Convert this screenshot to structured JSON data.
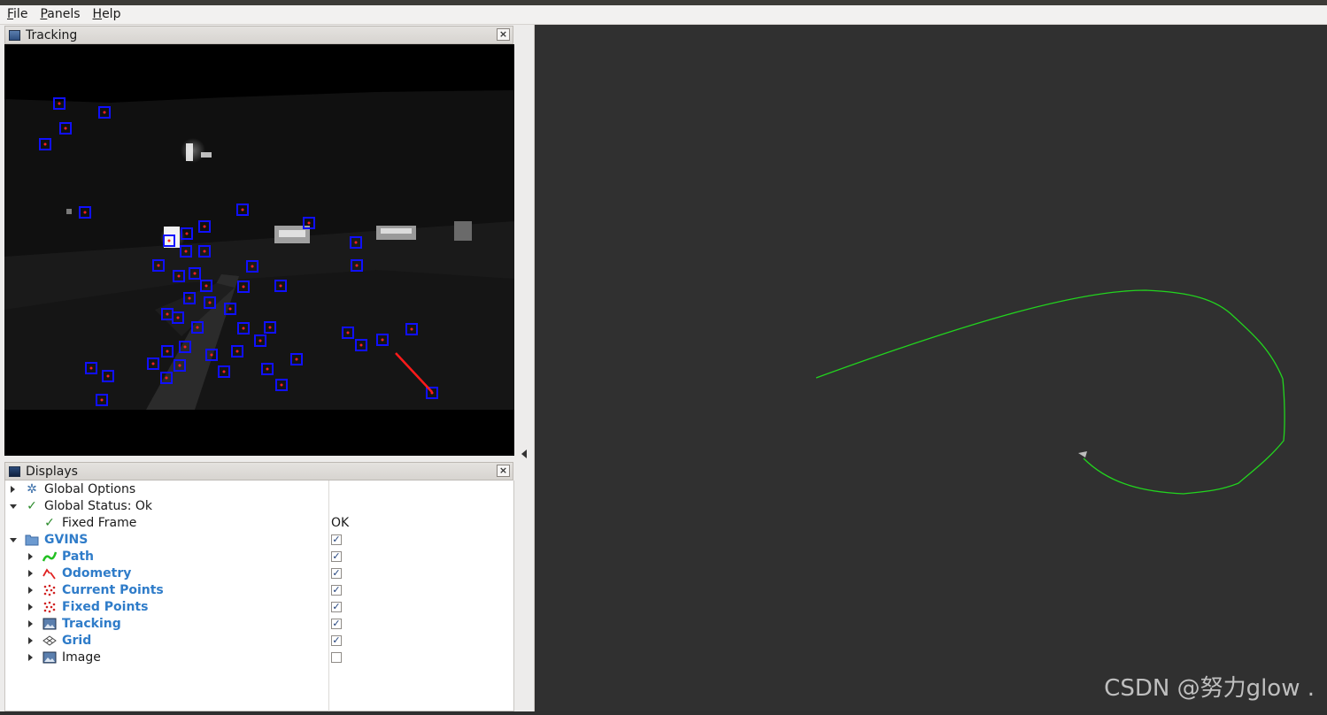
{
  "menu": {
    "file": {
      "acc": "F",
      "rest": "ile"
    },
    "panels": {
      "acc": "P",
      "rest": "anels"
    },
    "help": {
      "acc": "H",
      "rest": "elp"
    }
  },
  "tracking_panel": {
    "title": "Tracking",
    "close": "×"
  },
  "displays_panel": {
    "title": "Displays",
    "close": "×",
    "rows": [
      {
        "label": "Global Options",
        "icon": "gear-icon"
      },
      {
        "label": "Global Status: Ok",
        "icon": "check-icon"
      },
      {
        "label": "Fixed Frame",
        "icon": "check-icon",
        "value": "OK"
      },
      {
        "label": "GVINS",
        "icon": "folder-icon",
        "checked": true
      },
      {
        "label": "Path",
        "icon": "path-icon",
        "checked": true
      },
      {
        "label": "Odometry",
        "icon": "odometry-icon",
        "checked": true
      },
      {
        "label": "Current Points",
        "icon": "points-icon",
        "checked": true
      },
      {
        "label": "Fixed Points",
        "icon": "points-icon",
        "checked": true
      },
      {
        "label": "Tracking",
        "icon": "image-icon",
        "checked": true
      },
      {
        "label": "Grid",
        "icon": "grid-icon",
        "checked": true
      },
      {
        "label": "Image",
        "icon": "image-icon",
        "checked": false
      }
    ],
    "check_mark": "✓"
  },
  "watermark": "CSDN @努力glow .",
  "colors": {
    "trajectory": "#22d41e",
    "feature_box": "#1010ff",
    "feature_point": "#ff2020",
    "viewport_bg": "#303030"
  }
}
